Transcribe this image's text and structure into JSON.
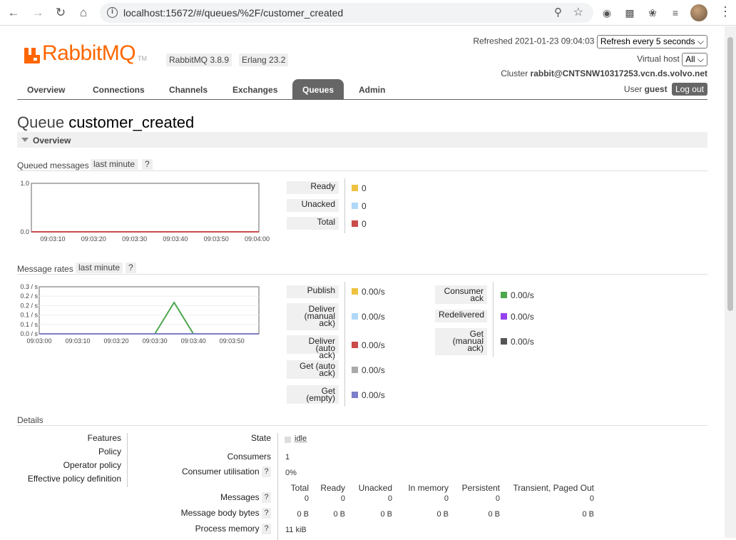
{
  "browser": {
    "url": "localhost:15672/#/queues/%2F/customer_created"
  },
  "header": {
    "logo_text": "RabbitMQ",
    "logo_tm": "TM",
    "rabbitmq_version": "RabbitMQ 3.8.9",
    "erlang_version": "Erlang 23.2",
    "refreshed": "Refreshed 2021-01-23 09:04:03",
    "refresh_select": "Refresh every 5 seconds",
    "vhost_label": "Virtual host",
    "vhost_select": "All",
    "cluster_label": "Cluster",
    "cluster_name": "rabbit@CNTSNW10317253.vcn.ds.volvo.net",
    "user_label": "User",
    "user_name": "guest",
    "logout": "Log out"
  },
  "tabs": [
    "Overview",
    "Connections",
    "Channels",
    "Exchanges",
    "Queues",
    "Admin"
  ],
  "page": {
    "title_prefix": "Queue",
    "queue_name": "customer_created",
    "section": "Overview"
  },
  "queued": {
    "title": "Queued messages",
    "range": "last minute",
    "help": "?",
    "legend": [
      {
        "label": "Ready",
        "color": "#edc240",
        "value": "0"
      },
      {
        "label": "Unacked",
        "color": "#afd8f8",
        "value": "0"
      },
      {
        "label": "Total",
        "color": "#cb4b4b",
        "value": "0"
      }
    ]
  },
  "rates": {
    "title": "Message rates",
    "range": "last minute",
    "help": "?",
    "legend_left": [
      {
        "label": "Publish",
        "color": "#edc240",
        "value": "0.00/s"
      },
      {
        "label": "Deliver (manual ack)",
        "color": "#afd8f8",
        "value": "0.00/s"
      },
      {
        "label": "Deliver (auto ack)",
        "color": "#cb4b4b",
        "value": "0.00/s"
      },
      {
        "label": "Get (auto ack)",
        "color": "#aaaaaa",
        "value": "0.00/s"
      },
      {
        "label": "Get (empty)",
        "color": "#7d7dc9",
        "value": "0.00/s"
      }
    ],
    "legend_right": [
      {
        "label": "Consumer ack",
        "color": "#4da74d",
        "value": "0.00/s"
      },
      {
        "label": "Redelivered",
        "color": "#9440ed",
        "value": "0.00/s"
      },
      {
        "label": "Get (manual ack)",
        "color": "#555555",
        "value": "0.00/s"
      }
    ]
  },
  "details": {
    "title": "Details",
    "left_labels": [
      "Features",
      "Policy",
      "Operator policy",
      "Effective policy definition"
    ],
    "state_label": "State",
    "state_value": "idle",
    "consumers_label": "Consumers",
    "consumers_value": "1",
    "utilisation_label": "Consumer utilisation",
    "utilisation_value": "0%",
    "columns": [
      "Total",
      "Ready",
      "Unacked",
      "In memory",
      "Persistent",
      "Transient, Paged Out"
    ],
    "messages_label": "Messages",
    "messages_values": [
      "0",
      "0",
      "0",
      "0",
      "0",
      "0"
    ],
    "body_label": "Message body bytes",
    "body_values": [
      "0 B",
      "0 B",
      "0 B",
      "0 B",
      "0 B",
      "0 B"
    ],
    "process_label": "Process memory",
    "process_value": "11 kiB"
  },
  "chart_data": [
    {
      "type": "line",
      "title": "Queued messages",
      "x": [
        "09:03:10",
        "09:03:20",
        "09:03:30",
        "09:03:40",
        "09:03:50",
        "09:04:00"
      ],
      "yticks": [
        "0.0",
        "1.0"
      ],
      "ylim": [
        0,
        1
      ],
      "series": [
        {
          "name": "Ready",
          "color": "#edc240",
          "values": [
            0,
            0,
            0,
            0,
            0,
            0
          ]
        },
        {
          "name": "Unacked",
          "color": "#afd8f8",
          "values": [
            0,
            0,
            0,
            0,
            0,
            0
          ]
        },
        {
          "name": "Total",
          "color": "#cb4b4b",
          "values": [
            0,
            0,
            0,
            0,
            0,
            0
          ]
        }
      ]
    },
    {
      "type": "line",
      "title": "Message rates",
      "x": [
        "09:03:00",
        "09:03:10",
        "09:03:20",
        "09:03:30",
        "09:03:40",
        "09:03:50"
      ],
      "yticks": [
        "0.0 / s",
        "0.1 / s",
        "0.1 / s",
        "0.2 / s",
        "0.2 / s",
        "0.3 / s"
      ],
      "ylim": [
        0,
        0.3
      ],
      "series": [
        {
          "name": "Consumer ack",
          "color": "#4da74d",
          "points": [
            [
              0,
              0
            ],
            [
              30,
              0
            ],
            [
              35,
              0.2
            ],
            [
              40,
              0
            ],
            [
              57,
              0
            ]
          ]
        },
        {
          "name": "Get (empty)",
          "color": "#7d7dc9",
          "points": [
            [
              0,
              0
            ],
            [
              57,
              0
            ]
          ]
        }
      ]
    }
  ]
}
